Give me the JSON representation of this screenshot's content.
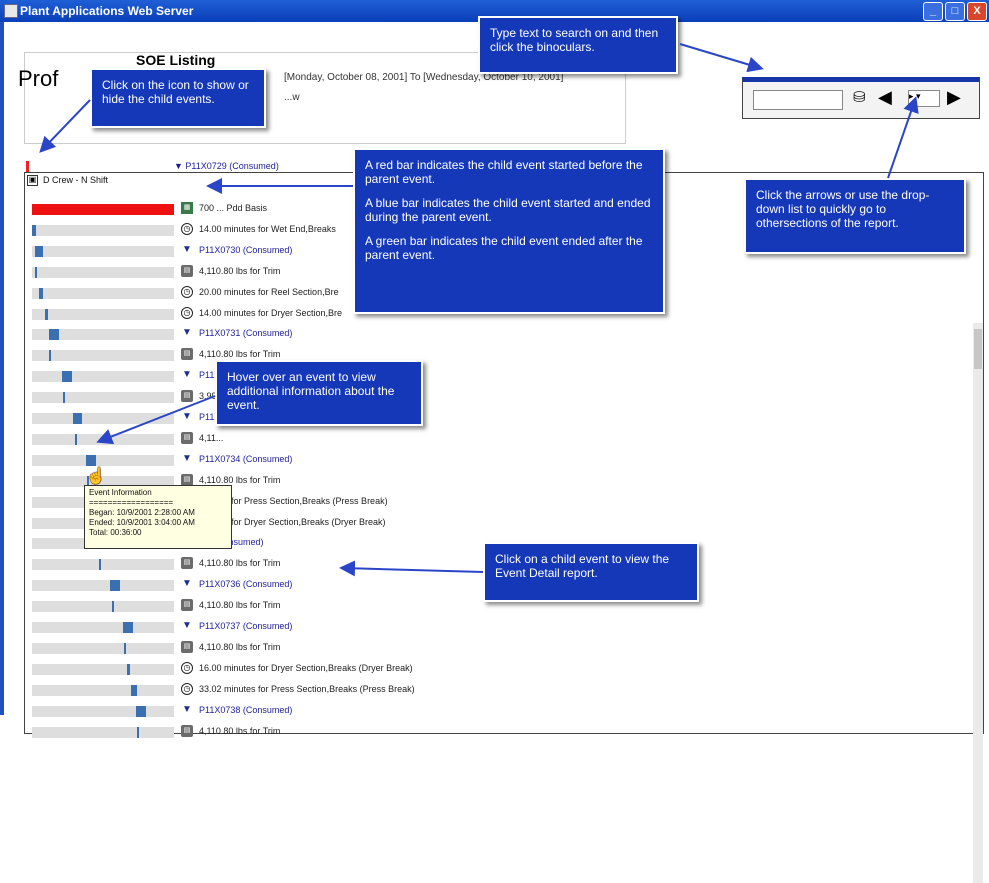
{
  "window": {
    "title": "Plant Applications Web Server",
    "btn_min": "_",
    "btn_max": "□",
    "btn_close": "X"
  },
  "report": {
    "title": "Prof",
    "subtitle": "SOE Listing",
    "date_range": "[Monday, October 08, 2001] To [Wednesday, October 10, 2001]",
    "sub_line": "...w"
  },
  "search": {
    "value": "",
    "binoculars_glyph": "⛁",
    "prev_glyph": "◀",
    "next_glyph": "▶",
    "nav_select_value": "▸ ▾"
  },
  "parent_event": {
    "text": "P11X0729 (Consumed)"
  },
  "crew_label": "D Crew - N Shift",
  "rows": [
    {
      "icon": "grid",
      "glyph": "▦",
      "text": "700 ... Pdd Basis",
      "link": false,
      "bar_color": "red",
      "start": 0.0,
      "width": 1.0
    },
    {
      "icon": "clock",
      "glyph": "◷",
      "text": "14.00 minutes for Wet End,Breaks",
      "link": false,
      "bar_color": "blue",
      "start": 0.0,
      "width": 0.03
    },
    {
      "icon": "flag",
      "glyph": "▼",
      "text": "P11X0730 (Consumed)",
      "link": true,
      "bar_color": "blue",
      "start": 0.02,
      "width": 0.06
    },
    {
      "icon": "bin",
      "glyph": "▤",
      "text": "4,110.80 lbs for Trim",
      "link": false,
      "bar_color": "blue",
      "start": 0.02,
      "width": 0.01
    },
    {
      "icon": "clock",
      "glyph": "◷",
      "text": "20.00 minutes for Reel Section,Bre",
      "link": false,
      "bar_color": "blue",
      "start": 0.05,
      "width": 0.03
    },
    {
      "icon": "clock",
      "glyph": "◷",
      "text": "14.00 minutes for Dryer Section,Bre",
      "link": false,
      "bar_color": "blue",
      "start": 0.09,
      "width": 0.02
    },
    {
      "icon": "flag",
      "glyph": "▼",
      "text": "P11X0731 (Consumed)",
      "link": true,
      "bar_color": "blue",
      "start": 0.12,
      "width": 0.07
    },
    {
      "icon": "bin",
      "glyph": "▤",
      "text": "4,110.80 lbs for Trim",
      "link": false,
      "bar_color": "blue",
      "start": 0.12,
      "width": 0.01
    },
    {
      "icon": "flag",
      "glyph": "▼",
      "text": "P11X0732 (Consumed)",
      "link": true,
      "bar_color": "blue",
      "start": 0.21,
      "width": 0.07
    },
    {
      "icon": "bin",
      "glyph": "▤",
      "text": "3,99...",
      "link": false,
      "bar_color": "blue",
      "start": 0.22,
      "width": 0.01
    },
    {
      "icon": "flag",
      "glyph": "▼",
      "text": "P11X...",
      "link": true,
      "bar_color": "blue",
      "start": 0.29,
      "width": 0.06
    },
    {
      "icon": "bin",
      "glyph": "▤",
      "text": "4,11...",
      "link": false,
      "bar_color": "blue",
      "start": 0.3,
      "width": 0.01
    },
    {
      "icon": "flag",
      "glyph": "▼",
      "text": "P11X0734 (Consumed)",
      "link": true,
      "bar_color": "blue",
      "start": 0.38,
      "width": 0.07
    },
    {
      "icon": "bin",
      "glyph": "▤",
      "text": "4,110.80 lbs for Trim",
      "link": false,
      "bar_color": "blue",
      "start": 0.39,
      "width": 0.01
    },
    {
      "icon": "clock",
      "glyph": "◷",
      "text": "...nutes for Press Section,Breaks (Press Break)",
      "link": false,
      "bar_color": "blue",
      "start": 0.42,
      "width": 0.02
    },
    {
      "icon": "clock",
      "glyph": "◷",
      "text": "...nutes for Dryer Section,Breaks (Dryer Break)",
      "link": false,
      "bar_color": "blue",
      "start": 0.44,
      "width": 0.02
    },
    {
      "icon": "flag",
      "glyph": "▼",
      "text": "...5 (Consumed)",
      "link": true,
      "bar_color": "blue",
      "start": 0.46,
      "width": 0.07
    },
    {
      "icon": "bin",
      "glyph": "▤",
      "text": "4,110.80 lbs for Trim",
      "link": false,
      "bar_color": "blue",
      "start": 0.47,
      "width": 0.01
    },
    {
      "icon": "flag",
      "glyph": "▼",
      "text": "P11X0736 (Consumed)",
      "link": true,
      "bar_color": "blue",
      "start": 0.55,
      "width": 0.07
    },
    {
      "icon": "bin",
      "glyph": "▤",
      "text": "4,110.80 lbs for Trim",
      "link": false,
      "bar_color": "blue",
      "start": 0.56,
      "width": 0.01
    },
    {
      "icon": "flag",
      "glyph": "▼",
      "text": "P11X0737 (Consumed)",
      "link": true,
      "bar_color": "blue",
      "start": 0.64,
      "width": 0.07
    },
    {
      "icon": "bin",
      "glyph": "▤",
      "text": "4,110.80 lbs for Trim",
      "link": false,
      "bar_color": "blue",
      "start": 0.65,
      "width": 0.01
    },
    {
      "icon": "clock",
      "glyph": "◷",
      "text": "16.00 minutes for Dryer Section,Breaks (Dryer Break)",
      "link": false,
      "bar_color": "blue",
      "start": 0.67,
      "width": 0.02
    },
    {
      "icon": "clock",
      "glyph": "◷",
      "text": "33.02 minutes for Press Section,Breaks (Press Break)",
      "link": false,
      "bar_color": "blue",
      "start": 0.7,
      "width": 0.04
    },
    {
      "icon": "flag",
      "glyph": "▼",
      "text": "P11X0738 (Consumed)",
      "link": true,
      "bar_color": "blue",
      "start": 0.73,
      "width": 0.07
    },
    {
      "icon": "bin",
      "glyph": "▤",
      "text": "4,110.80 lbs for Trim",
      "link": false,
      "bar_color": "blue",
      "start": 0.74,
      "width": 0.01
    }
  ],
  "tooltip": {
    "title": "Event Information",
    "separator": "==================",
    "began": "Began: 10/9/2001 2:28:00 AM",
    "ended": "Ended: 10/9/2001 3:04:00 AM",
    "total": "Total:   00:36:00"
  },
  "callouts": {
    "search": "Type text to search on and then click the binoculars.",
    "toggle": "Click on the icon to show or hide the child events.",
    "bars_red": "A red bar indicates the child event started before the parent event.",
    "bars_blue": "A blue bar indicates the child event started and ended during the parent event.",
    "bars_green": "A green bar indicates the child event ended after the parent event.",
    "arrows": "Click the arrows or use the drop-down list to quickly go to othersections of the report.",
    "hover": "Hover over an event to view additional information about the event.",
    "click_child": "Click on a child event to view the Event Detail report."
  },
  "colors": {
    "callout_bg": "#1538b8",
    "red_bar": "#ee1111",
    "blue_bar": "#3a6fb0",
    "green_bar": "#1f9a40",
    "link": "#1e1e9c"
  }
}
